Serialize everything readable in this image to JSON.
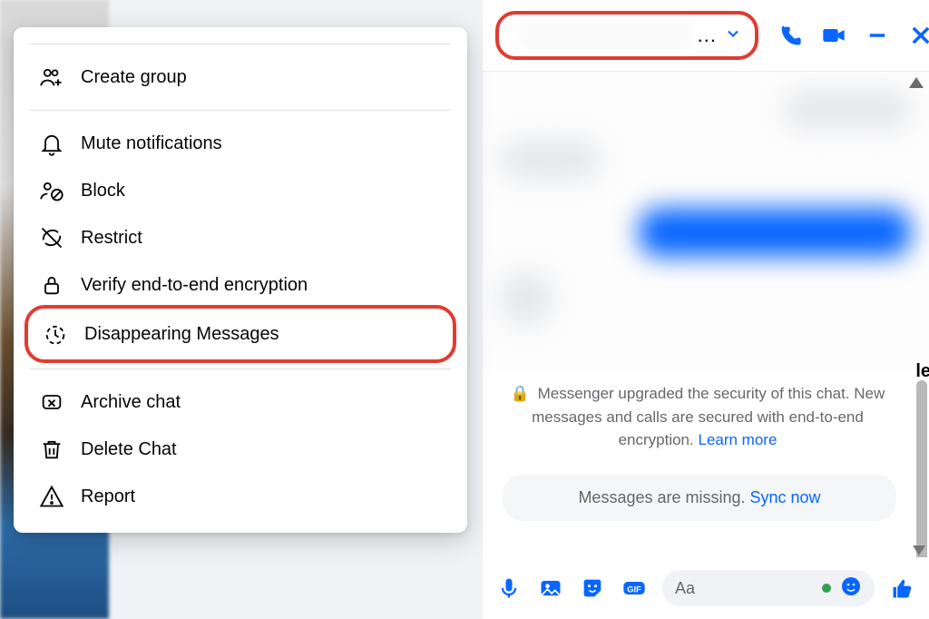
{
  "menu": {
    "create_group": "Create group",
    "mute_notifications": "Mute notifications",
    "block": "Block",
    "restrict": "Restrict",
    "verify_e2e": "Verify end-to-end encryption",
    "disappearing": "Disappearing Messages",
    "archive": "Archive chat",
    "delete": "Delete Chat",
    "report": "Report"
  },
  "chat_header": {
    "more_dots": "..."
  },
  "security_notice": {
    "line": "Messenger upgraded the security of this chat. New messages and calls are secured with end-to-end encryption.",
    "learn_more": "Learn more"
  },
  "missing": {
    "text": "Messages are missing. ",
    "sync_now": "Sync now"
  },
  "composer": {
    "placeholder": "Aa"
  },
  "right_edge": "le"
}
